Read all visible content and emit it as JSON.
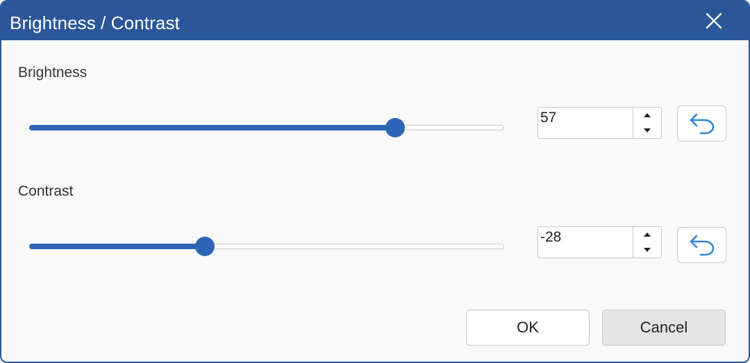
{
  "dialog": {
    "title": "Brightness / Contrast",
    "close_icon": "close-icon"
  },
  "brightness": {
    "label": "Brightness",
    "value": "57",
    "slider_fraction": 0.77,
    "reset_icon": "undo-arrow-icon"
  },
  "contrast": {
    "label": "Contrast",
    "value": "-28",
    "slider_fraction": 0.37,
    "reset_icon": "undo-arrow-icon"
  },
  "buttons": {
    "ok_label": "OK",
    "cancel_label": "Cancel"
  },
  "colors": {
    "titlebar": "#2b579a",
    "accent": "#2e64b5",
    "reset_icon": "#2f86d6"
  }
}
